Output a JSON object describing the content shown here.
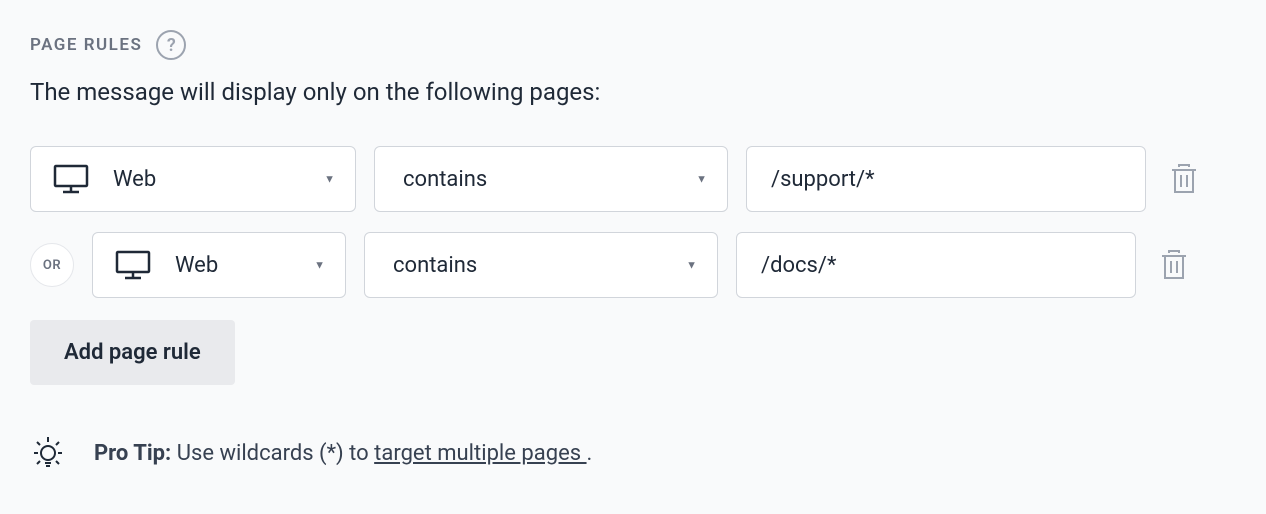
{
  "section": {
    "title": "PAGE RULES",
    "description": "The message will display only on the following pages:"
  },
  "rules": [
    {
      "logical_prefix": null,
      "platform": "Web",
      "operator": "contains",
      "value": "/support/*"
    },
    {
      "logical_prefix": "OR",
      "platform": "Web",
      "operator": "contains",
      "value": "/docs/*"
    }
  ],
  "actions": {
    "add_rule_label": "Add page rule"
  },
  "pro_tip": {
    "label": "Pro Tip:",
    "text_before": " Use wildcards (*) to ",
    "link_text": "target multiple pages ",
    "text_after": "."
  }
}
